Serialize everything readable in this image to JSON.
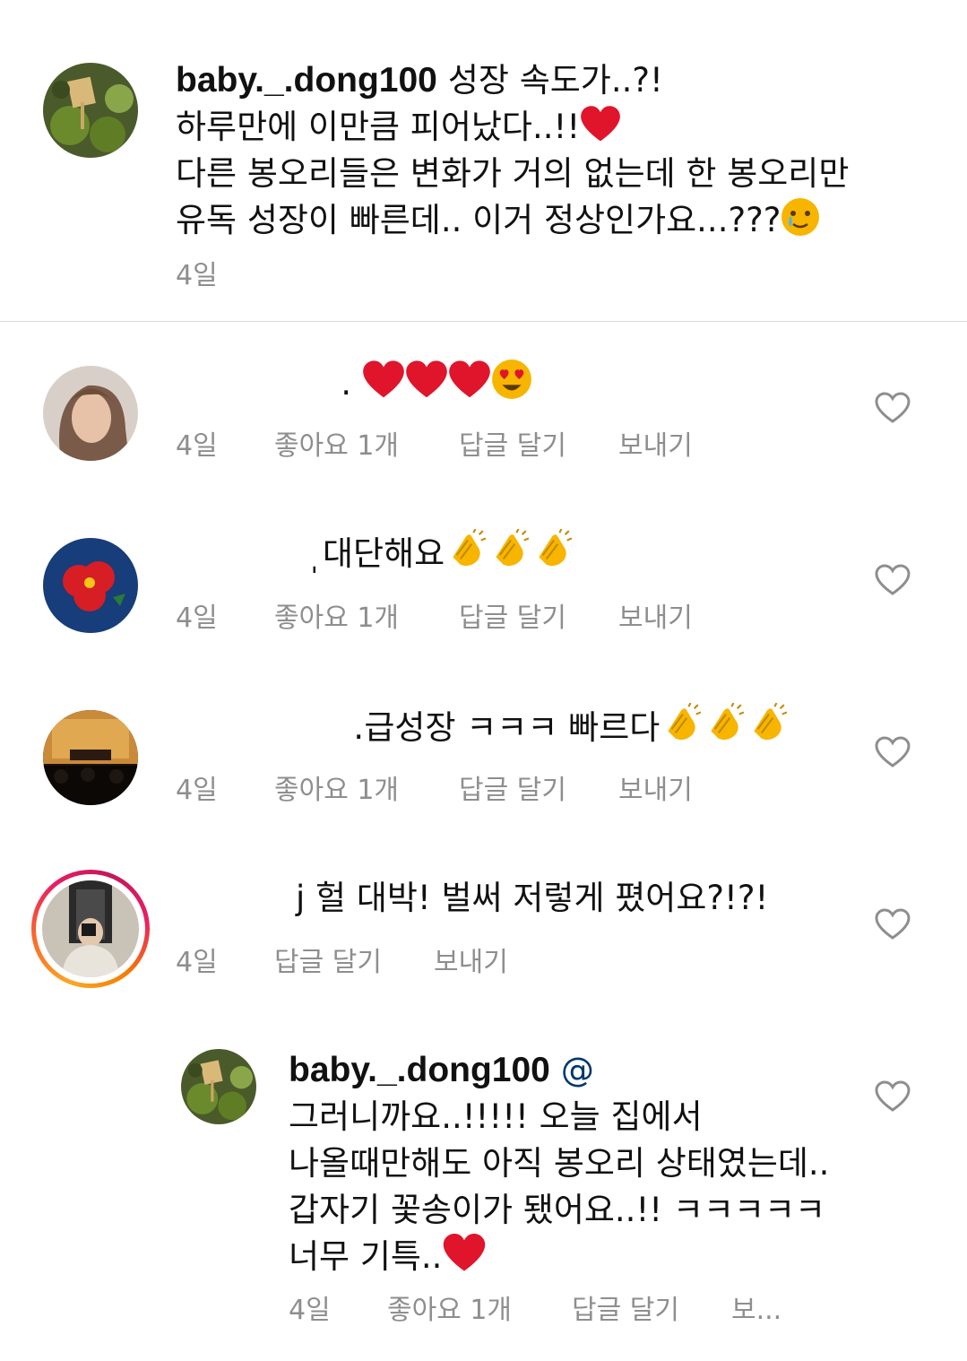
{
  "post_caption": {
    "username": "baby._.dong100",
    "lines": [
      "성장 속도가..?!",
      "하루만에 이만큼 피어났다..!!",
      "다른 봉오리들은 변화가 거의 없는데 한 봉오리만",
      "유독 성장이 빠른데.. 이거 정상인가요...???"
    ],
    "time": "4일"
  },
  "comments": [
    {
      "text": "",
      "emojis": [
        "heart",
        "heart",
        "heart",
        "heart-eyes"
      ],
      "time": "4일",
      "likes": "좋아요 1개",
      "reply": "답글 달기",
      "send": "보내기"
    },
    {
      "text": "대단해요",
      "emojis": [
        "clap",
        "clap",
        "clap"
      ],
      "time": "4일",
      "likes": "좋아요 1개",
      "reply": "답글 달기",
      "send": "보내기"
    },
    {
      "text": "급성장 ㅋㅋㅋ 빠르다",
      "emojis": [
        "clap",
        "clap",
        "clap"
      ],
      "time": "4일",
      "likes": "좋아요 1개",
      "reply": "답글 달기",
      "send": "보내기"
    },
    {
      "text": "헐 대박! 벌써 저렇게 폈어요?!?!",
      "time": "4일",
      "reply": "답글 달기",
      "send": "보내기"
    }
  ],
  "reply": {
    "username": "baby._.dong100",
    "mention": "@",
    "lines": [
      "그러니까요..!!!!! 오늘 집에서",
      "나올때만해도 아직 봉오리 상태였는데..",
      "갑자기 꽃송이가 됐어요..!! ㅋㅋㅋㅋㅋ",
      "너무 기특.."
    ],
    "time": "4일",
    "likes": "좋아요 1개",
    "reply_label": "답글 달기",
    "send_truncated": "보..."
  },
  "colors": {
    "meta": "#8e8e8e",
    "heart_emoji": "#e0142b",
    "emoji_yellow": "#f7b500",
    "mention": "#00376b"
  },
  "icons": [
    "like-heart-outline-icon",
    "red-heart-emoji",
    "heart-eyes-emoji",
    "clapping-hands-emoji",
    "crying-smile-emoji"
  ]
}
